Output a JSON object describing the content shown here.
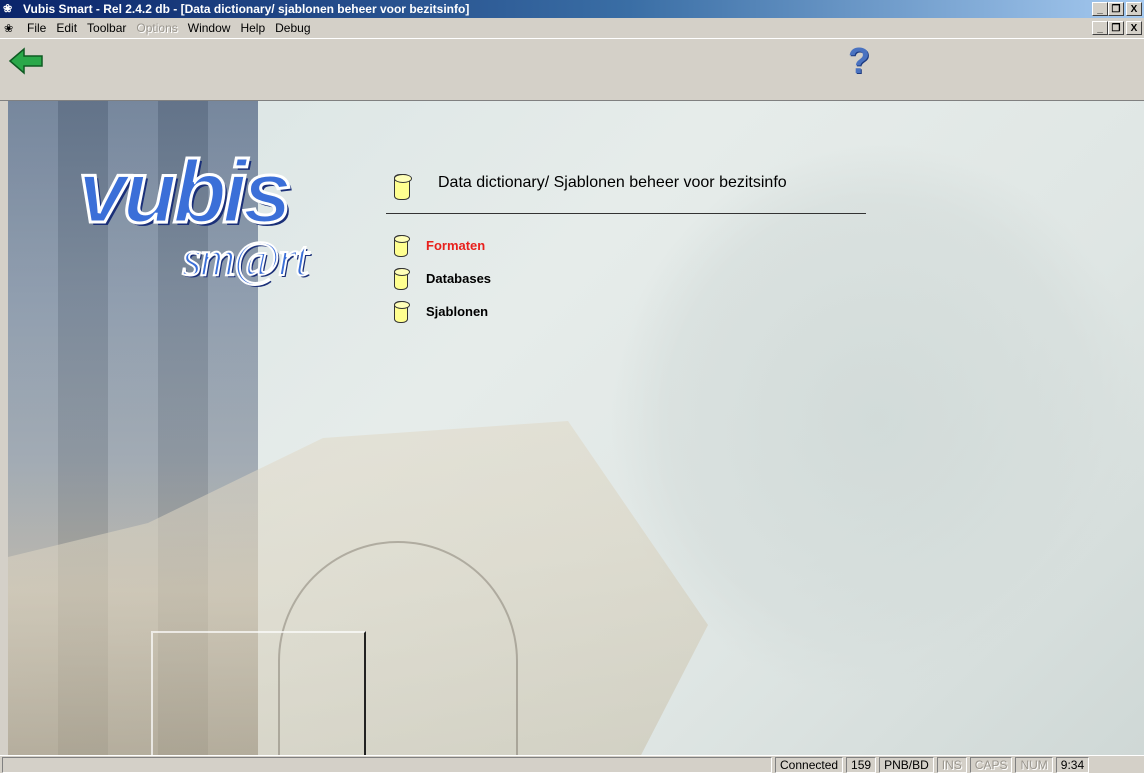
{
  "window": {
    "title": "Vubis Smart - Rel 2.4.2 db - [Data dictionary/ sjablonen beheer voor bezitsinfo]",
    "minimize": "_",
    "restore": "ő",
    "close": "X"
  },
  "menubar": {
    "items": [
      "File",
      "Edit",
      "Toolbar",
      "Options",
      "Window",
      "Help",
      "Debug"
    ],
    "disabled": [
      "Options"
    ]
  },
  "toolbar": {
    "back_icon": "left-arrow-icon",
    "help_label": "?"
  },
  "logo": {
    "line1": "vubis",
    "line2": "sm@rt"
  },
  "page": {
    "title": "Data dictionary/ Sjablonen beheer voor bezitsinfo",
    "options": [
      {
        "label": "Formaten",
        "active": true
      },
      {
        "label": "Databases",
        "active": false
      },
      {
        "label": "Sjablonen",
        "active": false
      }
    ]
  },
  "statusbar": {
    "connection": "Connected",
    "count": "159",
    "code": "PNB/BD",
    "ins": "INS",
    "caps": "CAPS",
    "num": "NUM",
    "time": "9:34"
  },
  "colors": {
    "active_option": "#e8201c",
    "title_bar_start": "#0a246a",
    "logo_blue": "#3b6fd8",
    "cylinder": "#ffff90"
  }
}
